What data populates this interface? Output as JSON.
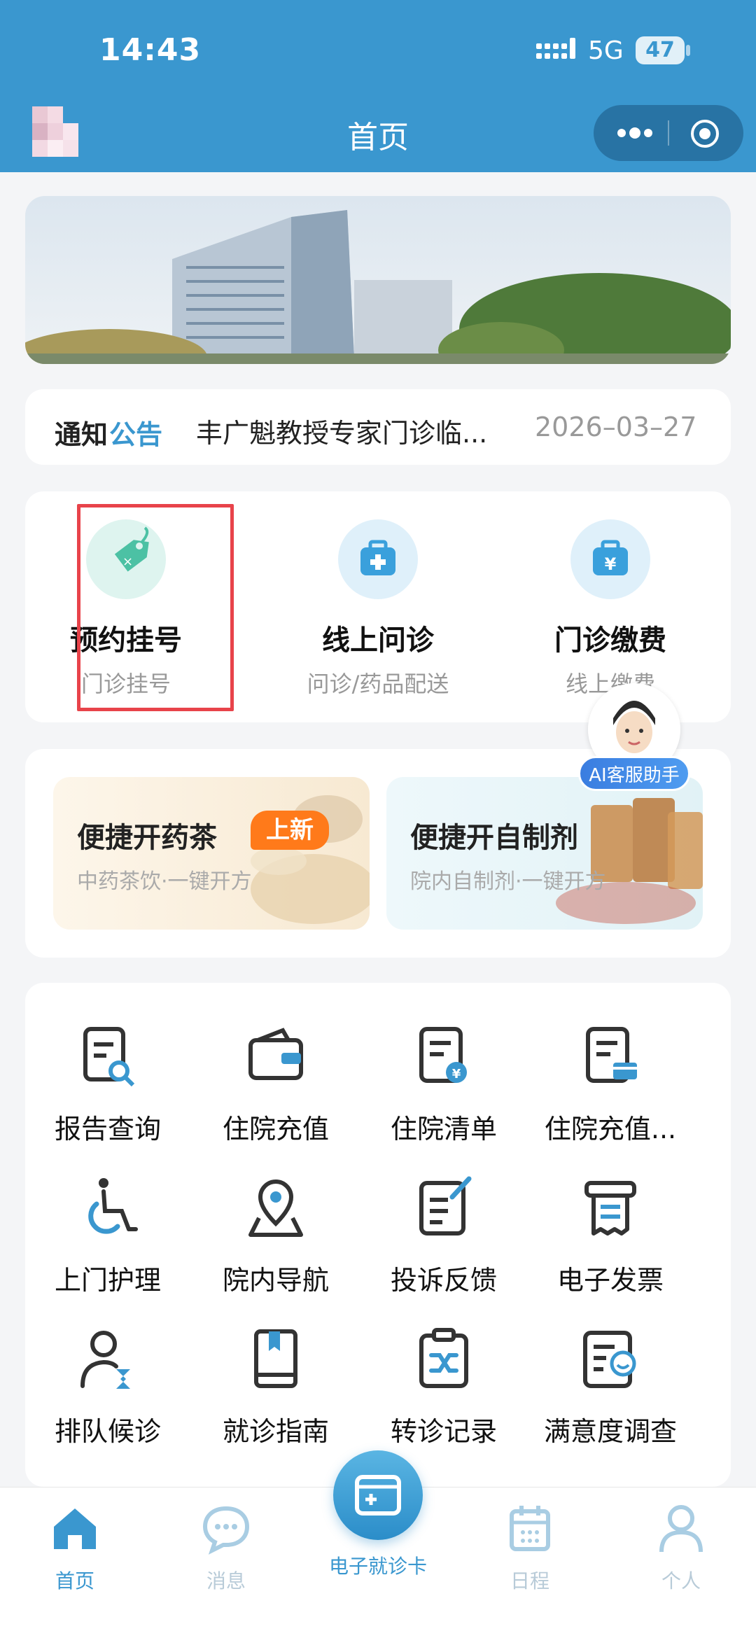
{
  "status_bar": {
    "time": "14:43",
    "network": "5G",
    "battery": "47"
  },
  "nav": {
    "title": "首页"
  },
  "notice": {
    "label_part1": "通知",
    "label_part2": "公告",
    "text": "丰广魁教授专家门诊临...",
    "date": "2026–03–27"
  },
  "services": [
    {
      "title": "预约挂号",
      "subtitle": "门诊挂号",
      "icon": "price-tag-icon",
      "color": "#4cc1a4"
    },
    {
      "title": "线上问诊",
      "subtitle": "问诊/药品配送",
      "icon": "medical-kit-icon",
      "color": "#3aa0dc"
    },
    {
      "title": "门诊缴费",
      "subtitle": "线上缴费",
      "icon": "payment-kit-icon",
      "color": "#3aa0dc"
    }
  ],
  "promos": [
    {
      "title": "便捷开药茶",
      "subtitle": "中药茶饮·一键开方",
      "badge": "上新"
    },
    {
      "title": "便捷开自制剂",
      "subtitle": "院内自制剂·一键开方"
    }
  ],
  "ai_helper": {
    "label": "AI客服助手"
  },
  "grid": [
    {
      "label": "报告查询",
      "icon": "report-search-icon"
    },
    {
      "label": "住院充值",
      "icon": "wallet-icon"
    },
    {
      "label": "住院清单",
      "icon": "bill-list-icon"
    },
    {
      "label": "住院充值...",
      "icon": "card-document-icon"
    },
    {
      "label": "上门护理",
      "icon": "wheelchair-icon"
    },
    {
      "label": "院内导航",
      "icon": "location-pin-icon"
    },
    {
      "label": "投诉反馈",
      "icon": "edit-document-icon"
    },
    {
      "label": "电子发票",
      "icon": "receipt-icon"
    },
    {
      "label": "排队候诊",
      "icon": "user-hourglass-icon"
    },
    {
      "label": "就诊指南",
      "icon": "guide-book-icon"
    },
    {
      "label": "转诊记录",
      "icon": "transfer-clipboard-icon"
    },
    {
      "label": "满意度调查",
      "icon": "smile-survey-icon"
    }
  ],
  "tabbar": [
    {
      "label": "首页",
      "icon": "home-icon",
      "active": true
    },
    {
      "label": "消息",
      "icon": "chat-icon",
      "active": false
    },
    {
      "label": "电子就诊卡",
      "icon": "medical-card-icon",
      "active": false
    },
    {
      "label": "日程",
      "icon": "calendar-icon",
      "active": false
    },
    {
      "label": "个人",
      "icon": "person-icon",
      "active": false
    }
  ],
  "colors": {
    "primary": "#3a97cf",
    "highlight_border": "#e8434a",
    "badge": "#ff7a1a"
  }
}
